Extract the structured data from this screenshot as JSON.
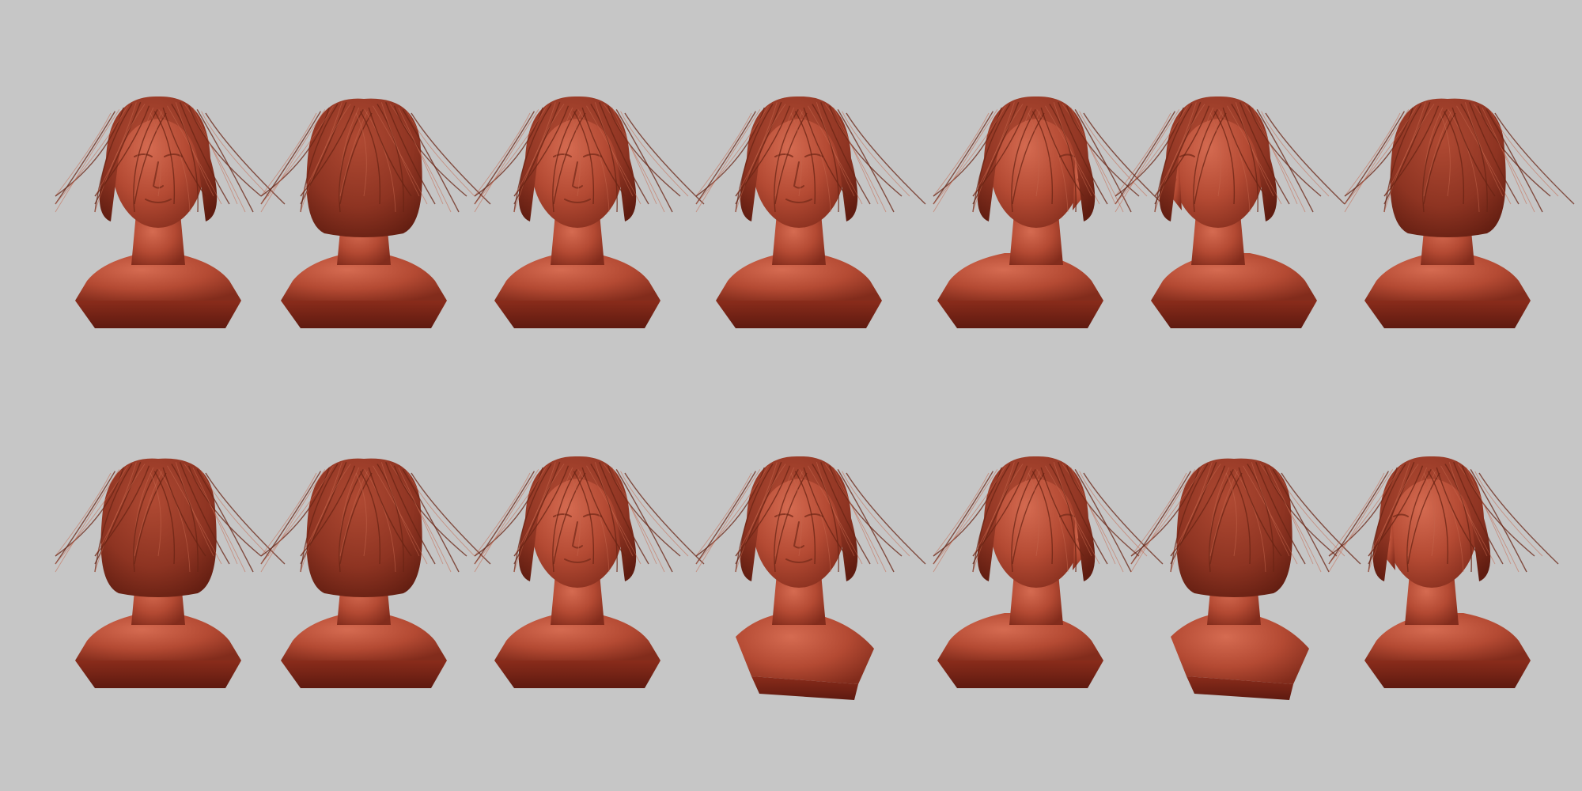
{
  "scene": {
    "background": "#c6c6c6",
    "material": {
      "skin": "#b44a33",
      "shadow": "#6b2014",
      "hair": "#8e3422",
      "base_bottom": "#5e1a10"
    },
    "rows": [
      {
        "views": [
          "front-down",
          "back-left",
          "front",
          "front",
          "right-profile",
          "left-three-quarter",
          "back-right"
        ]
      },
      {
        "views": [
          "back-right",
          "back",
          "front-down",
          "three-quarter-down",
          "right-profile",
          "back-left-low",
          "left-profile"
        ]
      }
    ]
  }
}
